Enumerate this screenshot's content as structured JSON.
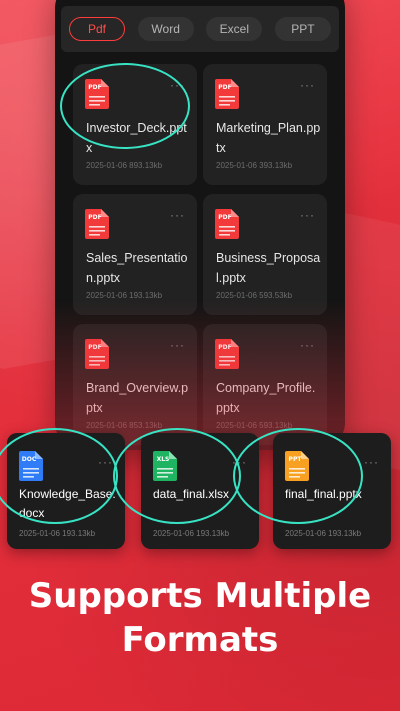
{
  "colors": {
    "background": "#e6323f",
    "card": "#222222",
    "highlight_circle": "#38e3c4",
    "active_tab": "#ff3b3b",
    "pdf_icon": "#f23a3a",
    "doc_icon": "#2f7cf6",
    "xls_icon": "#1fb462",
    "ppt_icon": "#f7a021"
  },
  "tabs": [
    {
      "label": "Pdf",
      "active": true
    },
    {
      "label": "Word",
      "active": false
    },
    {
      "label": "Excel",
      "active": false
    },
    {
      "label": "PPT",
      "active": false
    }
  ],
  "files": [
    {
      "name": "Investor_Deck.pptx",
      "meta": "2025-01-06 893.13kb",
      "icon": "PDF"
    },
    {
      "name": "Marketing_Plan.pptx",
      "meta": "2025-01-06 393.13kb",
      "icon": "PDF"
    },
    {
      "name": "Sales_Presentation.pptx",
      "meta": "2025-01-06 193.13kb",
      "icon": "PDF"
    },
    {
      "name": "Business_Proposal.pptx",
      "meta": "2025-01-06 593.53kb",
      "icon": "PDF"
    },
    {
      "name": "Brand_Overview.pptx",
      "meta": "2025-01-06 853.13kb",
      "icon": "PDF"
    },
    {
      "name": "Company_Profile.pptx",
      "meta": "2025-01-06 593.13kb",
      "icon": "PDF"
    }
  ],
  "featured": [
    {
      "name": "Knowledge_Base.docx",
      "meta": "2025-01-06 193.13kb",
      "icon": "DOC"
    },
    {
      "name": "data_final.xlsx",
      "meta": "2025-01-06 193.13kb",
      "icon": "XLS"
    },
    {
      "name": "final_final.pptx",
      "meta": "2025-01-06 193.13kb",
      "icon": "PPT"
    }
  ],
  "more_glyph": "···",
  "headline": {
    "line1": "Supports Multiple",
    "line2": "Formats"
  }
}
